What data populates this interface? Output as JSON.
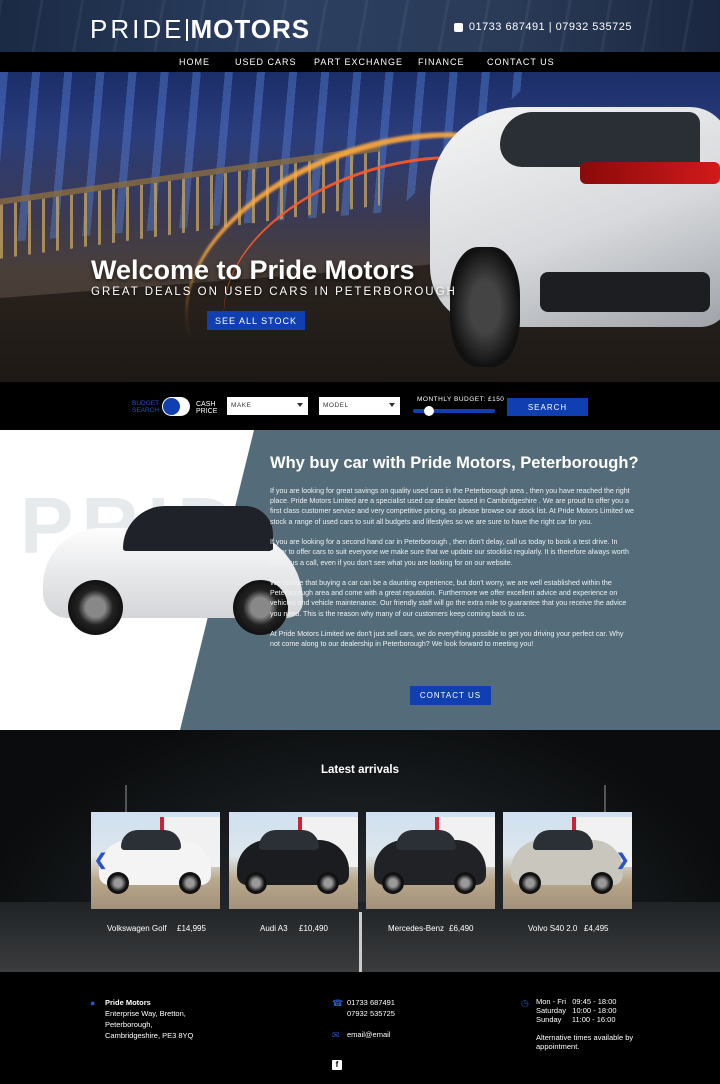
{
  "header": {
    "logo_left": "PRIDE",
    "logo_right": "MOTORS",
    "phone": "01733 687491 | 07932 535725"
  },
  "nav": [
    "HOME",
    "USED CARS",
    "PART EXCHANGE",
    "FINANCE",
    "CONTACT US"
  ],
  "hero": {
    "title": "Welcome to Pride Motors",
    "subtitle": "GREAT DEALS ON USED CARS IN PETERBOROUGH",
    "button": "SEE ALL STOCK"
  },
  "search": {
    "budget_label_1": "BUDGET",
    "budget_label_2": "SEARCH",
    "cash_label_1": "CASH",
    "cash_label_2": "PRICE",
    "make_placeholder": "MAKE",
    "model_placeholder": "MODEL",
    "monthly_budget": "MONTHLY BUDGET: £150",
    "button": "SEARCH",
    "slider_level": 0.2
  },
  "why": {
    "watermark": "PRIDE",
    "title": "Why buy car with Pride Motors, Peterborough?",
    "paragraphs": [
      "If you are looking for great savings on quality used cars in the Peterborough area , then you have reached the right place. Pride Motors Limited are a specialist used car dealer based in Cambridgeshire . We are proud to offer you a first class customer service and very competitive pricing, so please browse our stock list. At Pride Motors Limited we stock a range of used cars to suit all budgets and lifestyles so we are sure to have the right car for you.",
      "If you are looking for a second hand car in Peterborough , then don't delay, call us today to book a test drive. In order to offer cars to suit everyone we make sure that we update our stocklist regularly. It is therefore always worth giving us a call, even if you don't see what you are looking for on our website.",
      "We realise that buying a car can be a daunting experience, but don't worry, we are well established within the Peterborough area and come with a great reputation. Furthermore we offer excellent advice and experience on vehicles and vehicle maintenance. Our friendly staff will go the extra mile to guarantee that you receive the advice you need. This is the reason why many of our customers keep coming back to us.",
      "At Pride Motors Limited we don't just sell cars, we do everything possible to get you driving your perfect car. Why not come along to our dealership in Peterborough? We look forward to meeting you!"
    ],
    "button": "CONTACT US"
  },
  "arrivals": {
    "title": "Latest arrivals",
    "cars": [
      {
        "name": "Volkswagen Golf",
        "price": "£14,995",
        "color": "#f4f4f4"
      },
      {
        "name": "Audi A3",
        "price": "£10,490",
        "color": "#1a1c20"
      },
      {
        "name": "Mercedes-Benz",
        "price": "£6,490",
        "color": "#202226"
      },
      {
        "name": "Volvo S40 2.0",
        "price": "£4,495",
        "color": "#c9c6bd"
      }
    ]
  },
  "footer": {
    "address_name": "Pride Motors",
    "address_lines": [
      "Enterprise Way, Bretton,",
      "Peterborough,",
      "Cambridgeshire, PE3 8YQ"
    ],
    "phone1": "01733 687491",
    "phone2": "07932 535725",
    "email": "email@email",
    "hours": [
      {
        "day": "Mon - Fri",
        "time": "09:45 - 18:00"
      },
      {
        "day": "Saturday",
        "time": "10:00 - 18:00"
      },
      {
        "day": "Sunday",
        "time": "11:00 - 16:00"
      }
    ],
    "alt_times": "Alternative times available by appointment.",
    "facebook": "f"
  }
}
